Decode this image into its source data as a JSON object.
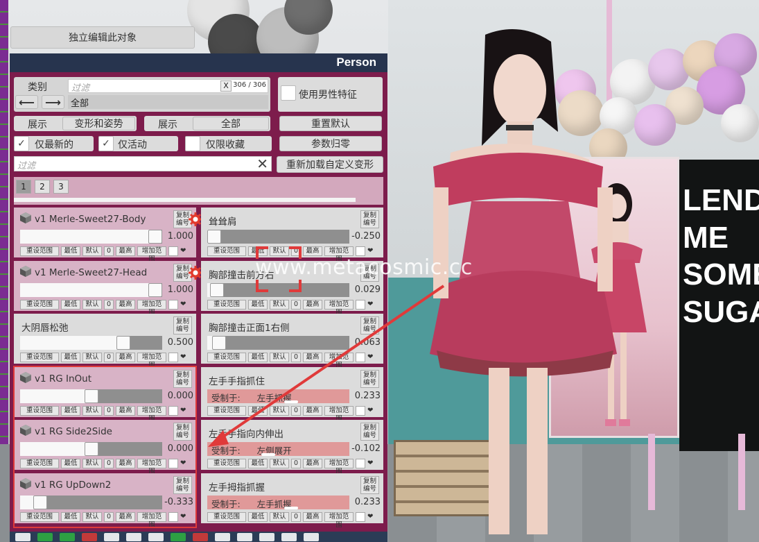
{
  "scene": {
    "board_text": "LEND\nME\nSOME\nSUGAR",
    "watermark": "www.metacosmic.cc"
  },
  "edit_object_button": "独立编辑此对象",
  "panel": {
    "title": "Person",
    "category_label": "类别",
    "filter_placeholder": "过滤",
    "clear_x": "X",
    "count": "306 / 306",
    "prev_arrow": "⟵",
    "next_arrow": "⟶",
    "category_value": "全部",
    "use_male_features": "使用男性特征",
    "show_label_1": "展示",
    "show_value_1": "变形和姿势",
    "show_label_2": "展示",
    "show_value_2": "全部",
    "reset_defaults": "重置默认",
    "only_latest": "仅最新的",
    "only_active": "仅活动",
    "only_favorites": "仅限收藏",
    "params_zero": "参数归零",
    "search_placeholder": "过滤",
    "search_clear": "✕",
    "reload_custom": "重新加载自定义变形",
    "pages": [
      "1",
      "2",
      "3"
    ]
  },
  "mini_labels": {
    "reset_range": "重设范围",
    "min": "最低",
    "default": "默认",
    "zero": "0",
    "max": "最高",
    "add_range": "增加范围",
    "heart": "❤"
  },
  "copy_label_1": "复制",
  "copy_label_2": "编号",
  "locked_prefix": "受制于:",
  "cards_left": [
    {
      "title": "v1  Merle-Sweet27-Body",
      "value": "1.000",
      "level": 1.0,
      "cube": true,
      "gear": true,
      "tone": "pink"
    },
    {
      "title": "v1  Merle-Sweet27-Head",
      "value": "1.000",
      "level": 1.0,
      "cube": true,
      "gear": true,
      "tone": "pink"
    },
    {
      "title": "大阴唇松弛",
      "value": "0.500",
      "level": 0.75,
      "cube": false,
      "gear": false,
      "tone": "grey"
    },
    {
      "title": "v1  RG InOut",
      "value": "0.000",
      "level": 0.5,
      "cube": true,
      "gear": false,
      "tone": "pink"
    },
    {
      "title": "v1  RG Side2Side",
      "value": "0.000",
      "level": 0.5,
      "cube": true,
      "gear": false,
      "tone": "pink"
    },
    {
      "title": "v1  RG UpDown2",
      "value": "-0.333",
      "level": 0.1,
      "cube": true,
      "gear": false,
      "tone": "pink"
    }
  ],
  "cards_right": [
    {
      "title": "耸耸肩",
      "value": "-0.250",
      "level": 0.0,
      "locked": false
    },
    {
      "title": "胸部撞击前方右",
      "value": "0.029",
      "level": 0.02,
      "locked": false
    },
    {
      "title": "胸部撞击正面1右侧",
      "value": "0.063",
      "level": 0.04,
      "locked": false
    },
    {
      "title": "左手手指抓住",
      "value": "0.233",
      "level": 0.6,
      "locked": true,
      "locked_by": "左手抓握"
    },
    {
      "title": "左手手指向内伸出",
      "value": "-0.102",
      "level": 0.42,
      "locked": true,
      "locked_by": "左侧展开"
    },
    {
      "title": "左手拇指抓握",
      "value": "0.233",
      "level": 0.6,
      "locked": true,
      "locked_by": "左手抓握"
    }
  ],
  "colors": {
    "panel": "#7d1c4c",
    "header": "#27344e",
    "card_pink": "#d8b3c6",
    "locked_track": "#e09999",
    "annotation_red": "#e03a3a"
  },
  "icons": [
    "cube-icon",
    "gear-icon",
    "check-icon",
    "left-arrow-icon",
    "right-arrow-icon",
    "close-icon",
    "heart-icon"
  ]
}
